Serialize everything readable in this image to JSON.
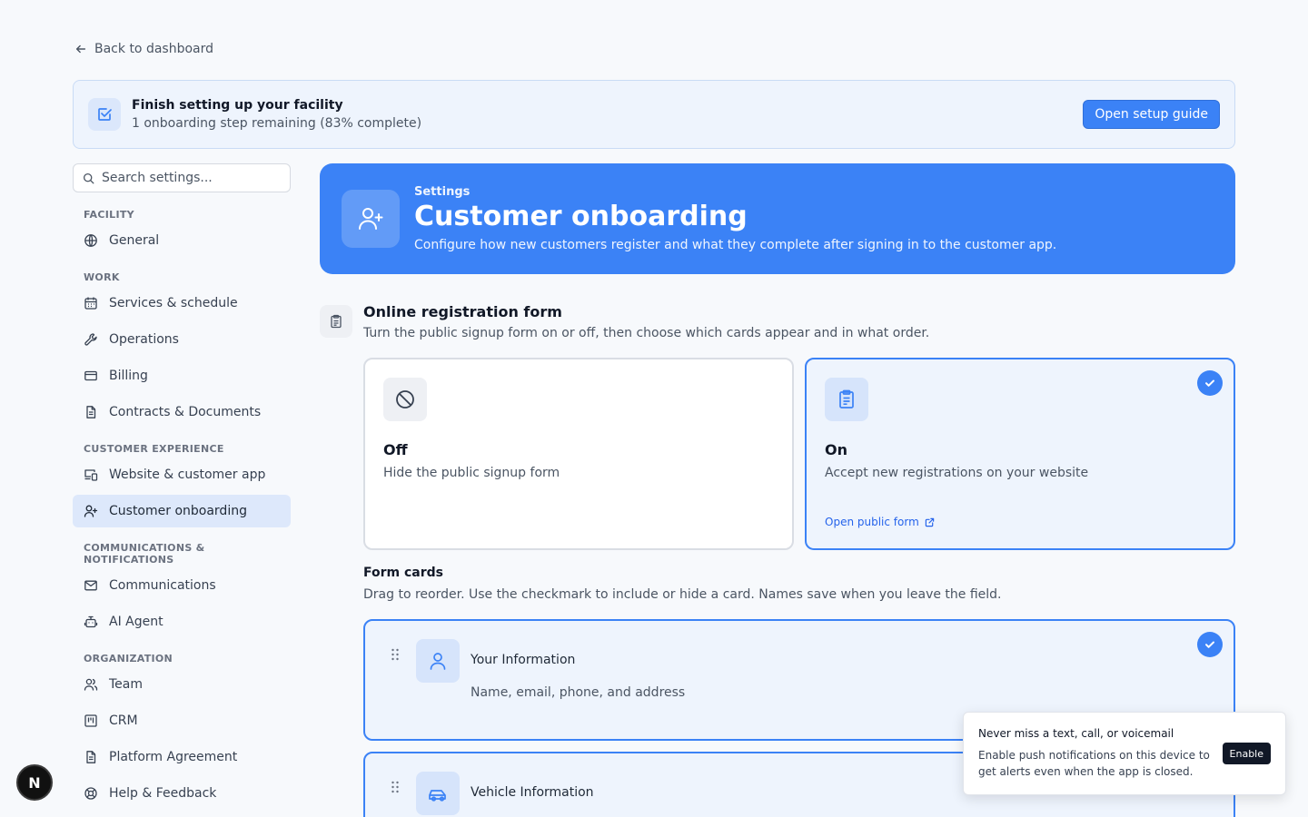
{
  "back_link": "Back to dashboard",
  "setup": {
    "title": "Finish setting up your facility",
    "subtitle": "1 onboarding step remaining (83% complete)",
    "button": "Open setup guide"
  },
  "sidebar": {
    "search_placeholder": "Search settings...",
    "sections": [
      {
        "label": "FACILITY",
        "items": [
          {
            "label": "General",
            "icon": "globe-icon"
          }
        ]
      },
      {
        "label": "WORK",
        "items": [
          {
            "label": "Services & schedule",
            "icon": "calendar-icon"
          },
          {
            "label": "Operations",
            "icon": "wrench-icon"
          },
          {
            "label": "Billing",
            "icon": "credit-card-icon"
          },
          {
            "label": "Contracts & Documents",
            "icon": "document-icon"
          }
        ]
      },
      {
        "label": "CUSTOMER EXPERIENCE",
        "items": [
          {
            "label": "Website & customer app",
            "icon": "devices-icon"
          },
          {
            "label": "Customer onboarding",
            "icon": "user-plus-icon",
            "active": true
          }
        ]
      },
      {
        "label": "COMMUNICATIONS & NOTIFICATIONS",
        "items": [
          {
            "label": "Communications",
            "icon": "mail-icon"
          },
          {
            "label": "AI Agent",
            "icon": "bot-icon"
          }
        ]
      },
      {
        "label": "ORGANIZATION",
        "items": [
          {
            "label": "Team",
            "icon": "users-icon"
          },
          {
            "label": "CRM",
            "icon": "kanban-icon"
          },
          {
            "label": "Platform Agreement",
            "icon": "document-icon"
          },
          {
            "label": "Help & Feedback",
            "icon": "lifebuoy-icon"
          }
        ]
      }
    ]
  },
  "hero": {
    "kicker": "Settings",
    "title": "Customer onboarding",
    "subtitle": "Configure how new customers register and what they complete after signing in to the customer app."
  },
  "registration": {
    "title": "Online registration form",
    "description": "Turn the public signup form on or off, then choose which cards appear and in what order.",
    "options": [
      {
        "title": "Off",
        "description": "Hide the public signup form",
        "selected": false
      },
      {
        "title": "On",
        "description": "Accept new registrations on your website",
        "selected": true,
        "link": "Open public form"
      }
    ]
  },
  "form_cards": {
    "title": "Form cards",
    "description": "Drag to reorder. Use the checkmark to include or hide a card. Names save when you leave the field.",
    "cards": [
      {
        "name": "Your Information",
        "description": "Name, email, phone, and address",
        "icon": "user-icon",
        "enabled": true
      },
      {
        "name": "Vehicle Information",
        "description": "",
        "icon": "car-icon",
        "enabled": true
      }
    ]
  },
  "toast": {
    "title": "Never miss a text, call, or voicemail",
    "description": "Enable push notifications on this device to get alerts even when the app is closed.",
    "button": "Enable"
  },
  "badge": "N",
  "colors": {
    "accent": "#3b82f6",
    "accent_bg": "#eef4fd"
  }
}
